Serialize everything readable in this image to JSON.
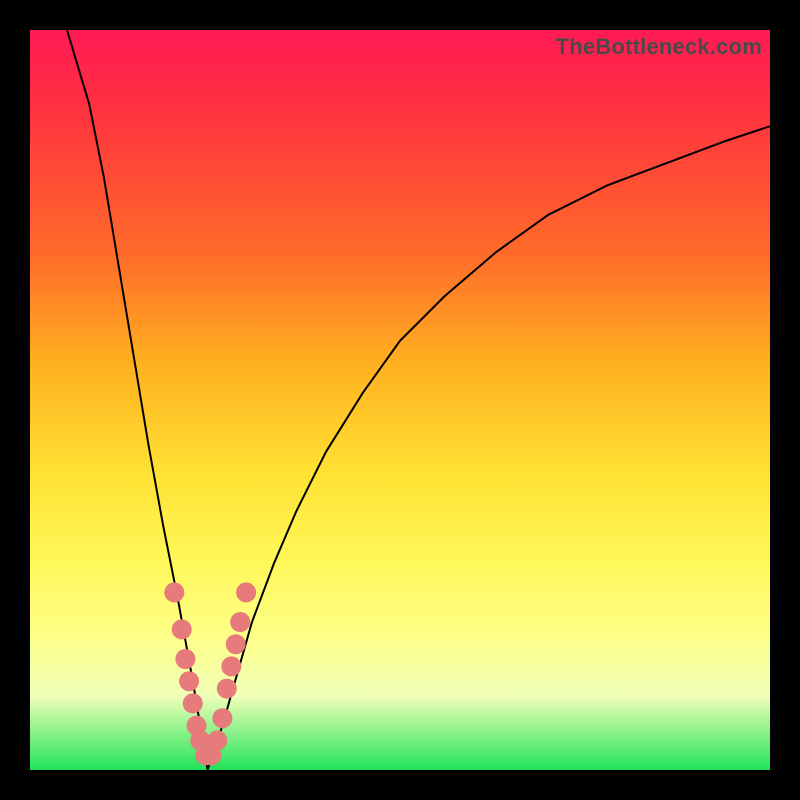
{
  "watermark": "TheBottleneck.com",
  "colors": {
    "frame": "#000000",
    "curve_stroke": "#000000",
    "dot_fill": "#e77a7a",
    "gradient_top": "#ff1a55",
    "gradient_bottom": "#21e35a"
  },
  "chart_data": {
    "type": "line",
    "title": "",
    "xlabel": "",
    "ylabel": "",
    "xlim": [
      0,
      100
    ],
    "ylim": [
      0,
      100
    ],
    "grid": false,
    "note": "V-shaped bottleneck curve. x roughly = component relative rating, y roughly = bottleneck % (0 at bottom/green, 100 at top/red). Minimum near x≈24. Right branch asymptotes toward ~85–90%.",
    "series": [
      {
        "name": "left_branch",
        "x": [
          5,
          8,
          10,
          12,
          14,
          16,
          18,
          20,
          22,
          23,
          24
        ],
        "y": [
          100,
          90,
          80,
          68,
          56,
          44,
          33,
          23,
          12,
          6,
          0
        ]
      },
      {
        "name": "right_branch",
        "x": [
          24,
          26,
          28,
          30,
          33,
          36,
          40,
          45,
          50,
          56,
          63,
          70,
          78,
          86,
          94,
          100
        ],
        "y": [
          0,
          6,
          13,
          20,
          28,
          35,
          43,
          51,
          58,
          64,
          70,
          75,
          79,
          82,
          85,
          87
        ]
      }
    ],
    "highlight_points": {
      "name": "sampled_hardware",
      "comment": "pink dots clustered near the minimum",
      "approx_xy": [
        [
          19.5,
          24
        ],
        [
          20.5,
          19
        ],
        [
          21,
          15
        ],
        [
          21.5,
          12
        ],
        [
          22,
          9
        ],
        [
          22.5,
          6
        ],
        [
          23,
          4
        ],
        [
          23.7,
          2
        ],
        [
          24.5,
          2
        ],
        [
          25.3,
          4
        ],
        [
          26,
          7
        ],
        [
          26.6,
          11
        ],
        [
          27.2,
          14
        ],
        [
          27.8,
          17
        ],
        [
          28.4,
          20
        ],
        [
          29.2,
          24
        ]
      ]
    }
  }
}
